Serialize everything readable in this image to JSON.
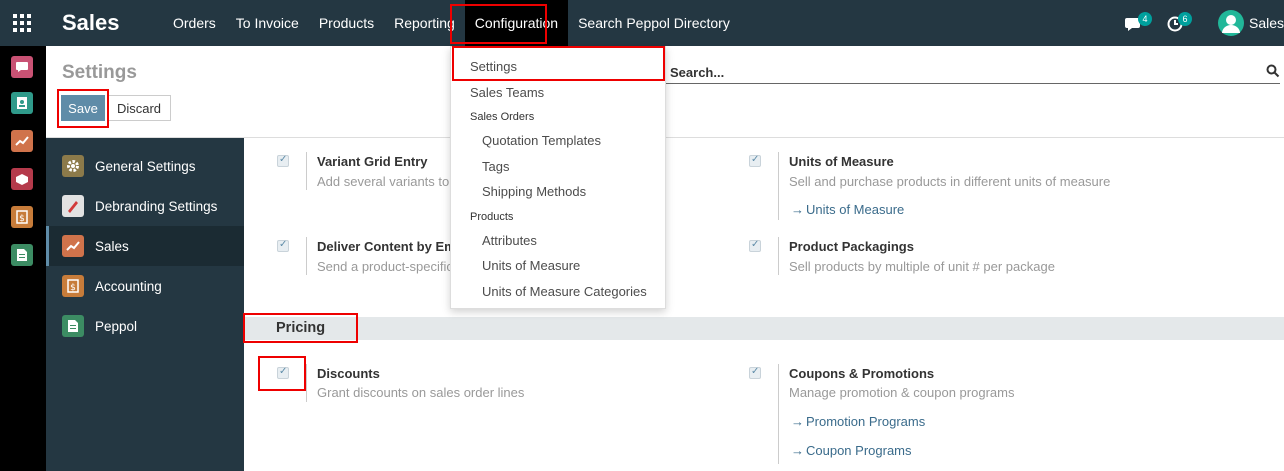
{
  "navbar": {
    "brand": "Sales",
    "menu": [
      {
        "label": "Orders"
      },
      {
        "label": "To Invoice"
      },
      {
        "label": "Products"
      },
      {
        "label": "Reporting"
      },
      {
        "label": "Configuration",
        "active": true
      },
      {
        "label": "Search Peppol Directory"
      }
    ],
    "messages_count": "4",
    "activities_count": "6",
    "user_name": "Sales"
  },
  "appbar": {
    "icons": [
      "discuss-icon",
      "contacts-icon",
      "sales-icon",
      "inventory-icon",
      "invoicing-icon",
      "peppol-icon"
    ]
  },
  "control": {
    "title": "Settings",
    "save_label": "Save",
    "discard_label": "Discard",
    "search_placeholder": "Search..."
  },
  "sidebar": {
    "items": [
      {
        "label": "General Settings"
      },
      {
        "label": "Debranding Settings"
      },
      {
        "label": "Sales",
        "active": true
      },
      {
        "label": "Accounting"
      },
      {
        "label": "Peppol"
      }
    ]
  },
  "dropdown": {
    "items": [
      {
        "label": "Settings",
        "type": "item"
      },
      {
        "label": "Sales Teams",
        "type": "item"
      },
      {
        "label": "Sales Orders",
        "type": "header"
      },
      {
        "label": "Quotation Templates",
        "type": "subitem"
      },
      {
        "label": "Tags",
        "type": "subitem"
      },
      {
        "label": "Shipping Methods",
        "type": "subitem"
      },
      {
        "label": "Products",
        "type": "header"
      },
      {
        "label": "Attributes",
        "type": "subitem"
      },
      {
        "label": "Units of Measure",
        "type": "subitem"
      },
      {
        "label": "Units of Measure Categories",
        "type": "subitem"
      }
    ]
  },
  "settings": {
    "variant_grid": {
      "title": "Variant Grid Entry",
      "desc": "Add several variants to"
    },
    "units_of_measure": {
      "title": "Units of Measure",
      "desc": "Sell and purchase products in different units of measure",
      "link": "Units of Measure"
    },
    "deliver_content": {
      "title": "Deliver Content by Ema",
      "desc": "Send a product-specific"
    },
    "product_packagings": {
      "title": "Product Packagings",
      "desc": "Sell products by multiple of unit # per package"
    },
    "pricing_section": "Pricing",
    "discounts": {
      "title": "Discounts",
      "desc": "Grant discounts on sales order lines"
    },
    "coupons": {
      "title": "Coupons & Promotions",
      "desc": "Manage promotion & coupon programs",
      "link1": "Promotion Programs",
      "link2": "Coupon Programs"
    }
  },
  "colors": {
    "navbar": "#243742",
    "accent": "#5f8ca8",
    "highlight": "#e00000"
  }
}
